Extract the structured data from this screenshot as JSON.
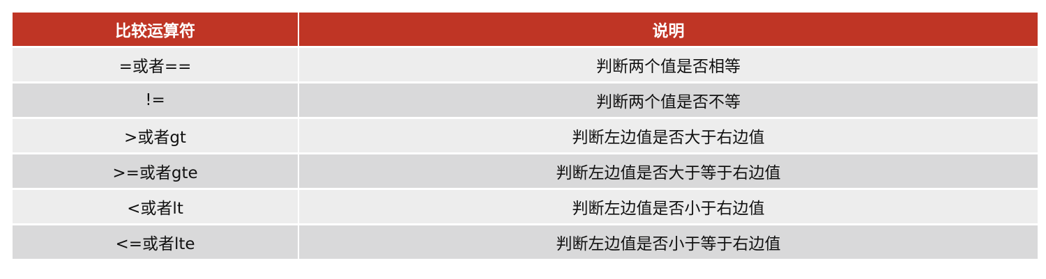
{
  "table": {
    "headers": [
      "比较运算符",
      "说明"
    ],
    "rows": [
      {
        "operator": "=或者==",
        "description": "判断两个值是否相等"
      },
      {
        "operator": "!=",
        "description": "判断两个值是否不等"
      },
      {
        "operator": ">或者gt",
        "description": "判断左边值是否大于右边值"
      },
      {
        "operator": ">=或者gte",
        "description": "判断左边值是否大于等于右边值"
      },
      {
        "operator": "<或者lt",
        "description": "判断左边值是否小于右边值"
      },
      {
        "operator": "<=或者lte",
        "description": "判断左边值是否小于等于右边值"
      }
    ]
  },
  "colors": {
    "header_bg": "#bf3525",
    "header_text": "#ffffff",
    "row_light": "#ededed",
    "row_dark": "#d9d9da"
  }
}
